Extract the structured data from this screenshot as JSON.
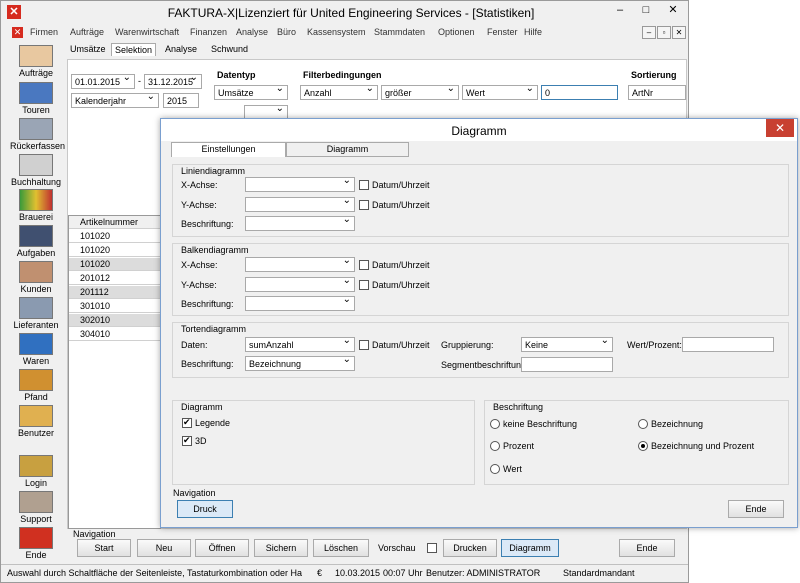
{
  "window": {
    "title": "FAKTURA-X|Lizenziert für United Engineering Services - [Statistiken]",
    "min": "‒",
    "max": "□",
    "close": "✕"
  },
  "menu": {
    "items": [
      "Firmen",
      "Aufträge",
      "Warenwirtschaft",
      "Finanzen",
      "Analyse",
      "Büro",
      "Kassensystem",
      "Stammdaten",
      "Optionen",
      "Fenster",
      "Hilfe"
    ],
    "mdi_min": "‒",
    "mdi_max": "▫",
    "mdi_close": "✕"
  },
  "sidebar": {
    "items": [
      "Aufträge",
      "Touren",
      "Rückerfassen",
      "Buchhaltung",
      "Brauerei",
      "Aufgaben",
      "Kunden",
      "Lieferanten",
      "Waren",
      "Pfand",
      "Benutzer",
      "Login",
      "Support",
      "Ende"
    ]
  },
  "tabs": [
    "Umsätze",
    "Selektion",
    "Analyse",
    "Schwund"
  ],
  "filter": {
    "date_from": "01.01.2015",
    "date_to": "31.12.2015",
    "period": "Kalenderjahr",
    "year": "2015",
    "headers": {
      "datentyp": "Datentyp",
      "filter": "Filterbedingungen",
      "sort": "Sortierung"
    },
    "datentyp": "Umsätze",
    "field": "Anzahl",
    "operator": "größer",
    "mode": "Wert",
    "value": "0",
    "sort": "ArtNr"
  },
  "grid": {
    "header": "Artikelnummer",
    "rows": [
      "101020",
      "101020",
      "101020",
      "201012",
      "201112",
      "301010",
      "302010",
      "304010"
    ]
  },
  "navigation": {
    "label": "Navigation",
    "start": "Start",
    "neu": "Neu",
    "oeffnen": "Öffnen",
    "sichern": "Sichern",
    "loeschen": "Löschen",
    "vorschau": "Vorschau",
    "drucken": "Drucken",
    "diagramm": "Diagramm",
    "ende": "Ende"
  },
  "status": {
    "hint": "Auswahl durch Schaltfläche der Seitenleiste, Tastaturkombination oder Ha",
    "currency": "€",
    "date": "10.03.2015",
    "time": "00:07 Uhr",
    "user": "Benutzer: ADMINISTRATOR",
    "mandant": "Standardmandant"
  },
  "dialog": {
    "title": "Diagramm",
    "close": "✕",
    "tabs": [
      "Einstellungen",
      "Diagramm"
    ],
    "line": {
      "title": "Liniendiagramm",
      "x": "X-Achse:",
      "y": "Y-Achse:",
      "label": "Beschriftung:",
      "datetime": "Datum/Uhrzeit"
    },
    "bar": {
      "title": "Balkendiagramm",
      "x": "X-Achse:",
      "y": "Y-Achse:",
      "label": "Beschriftung:",
      "datetime": "Datum/Uhrzeit"
    },
    "pie": {
      "title": "Tortendiagramm",
      "data": "Daten:",
      "data_value": "sumAnzahl",
      "datetime": "Datum/Uhrzeit",
      "label": "Beschriftung:",
      "label_value": "Bezeichnung",
      "group": "Gruppierung:",
      "group_value": "Keine",
      "wp": "Wert/Prozent:",
      "seg": "Segmentbeschriftung:"
    },
    "diagram": {
      "title": "Diagramm",
      "legend": "Legende",
      "threed": "3D"
    },
    "caption": {
      "title": "Beschriftung",
      "none": "keine Beschriftung",
      "name": "Bezeichnung",
      "percent": "Prozent",
      "name_percent": "Bezeichnung und Prozent",
      "value": "Wert"
    },
    "nav": {
      "label": "Navigation",
      "print": "Druck",
      "end": "Ende"
    }
  }
}
